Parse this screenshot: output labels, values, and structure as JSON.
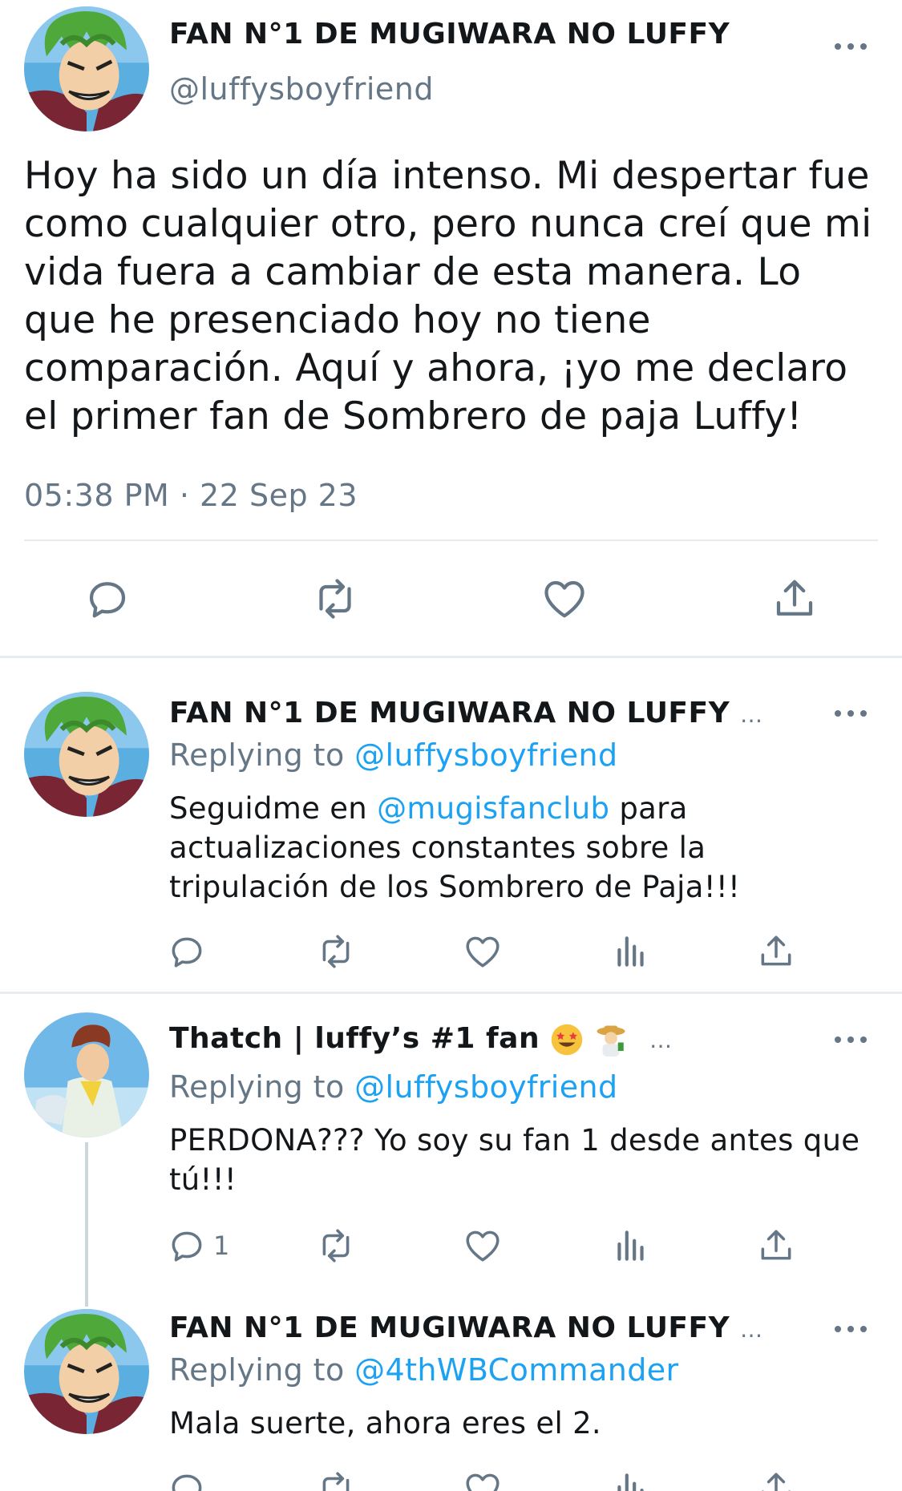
{
  "main_tweet": {
    "name": "FAN N°1 DE MUGIWARA NO LUFFY",
    "handle": "@luffysboyfriend",
    "text": "Hoy ha sido un día intenso. Mi despertar fue como cualquier otro, pero nunca creí que mi vida fuera a cambiar de esta manera. Lo que he presenciado hoy no tiene comparación. Aquí y ahora, ¡yo me declaro el primer fan de Sombrero de paja Luffy!",
    "timestamp": "05:38 PM · 22 Sep 23"
  },
  "replies": [
    {
      "name": "FAN N°1 DE MUGIWARA NO LUFFY",
      "ellipsis": "...",
      "replying_prefix": "Replying to ",
      "replying_to": "@luffysboyfriend",
      "text_before": "Seguidme en ",
      "mention": "@mugisfanclub",
      "text_after": " para actualizaciones constantes sobre la tripulación de los Sombrero de Paja!!!"
    },
    {
      "name": "Thatch | luffy’s #1 fan",
      "ellipsis": "...",
      "replying_prefix": "Replying to ",
      "replying_to": "@luffysboyfriend",
      "text": "PERDONA??? Yo soy su fan 1 desde antes que tú!!!",
      "reply_count": "1"
    },
    {
      "name": "FAN N°1 DE MUGIWARA NO LUFFY",
      "ellipsis": "...",
      "replying_prefix": "Replying to ",
      "replying_to": "@4thWBCommander",
      "text": "Mala suerte, ahora eres el 2."
    }
  ],
  "icons": {
    "reply": "reply-icon",
    "retweet": "retweet-icon",
    "like": "heart-icon",
    "analytics": "analytics-icon",
    "share": "share-icon",
    "more": "more-icon"
  },
  "colors": {
    "accent": "#1da1f2",
    "secondary_text": "#657786",
    "divider": "#e6ecf0"
  }
}
